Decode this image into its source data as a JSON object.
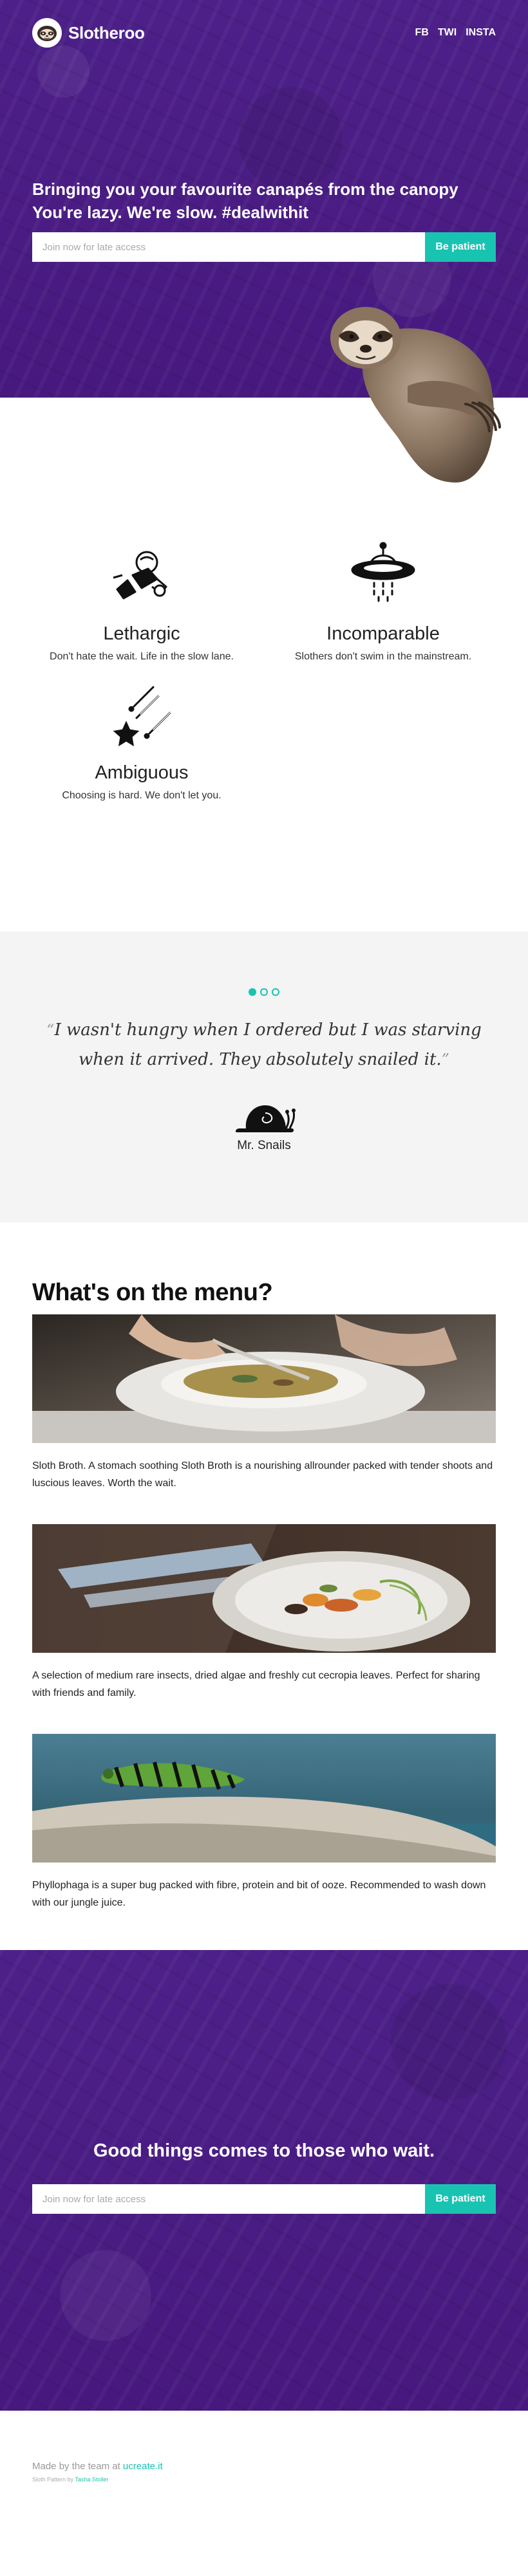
{
  "brand": {
    "name": "Slotheroo",
    "logo_icon": "sloth-face-icon"
  },
  "nav": {
    "items": [
      "FB",
      "TWI",
      "INSTA"
    ]
  },
  "hero": {
    "title": "Bringing you your favourite canapés from the canopy You're lazy. We're slow. #dealwithit",
    "input_placeholder": "Join now for late access",
    "button_label": "Be patient",
    "image_icon": "sloth-hanging-illustration"
  },
  "features": [
    {
      "icon": "astronaut-icon",
      "title": "Lethargic",
      "desc": "Don't hate the wait. Life in the slow lane."
    },
    {
      "icon": "ufo-icon",
      "title": "Incomparable",
      "desc": "Slothers don't swim in the mainstream."
    },
    {
      "icon": "shooting-stars-icon",
      "title": "Ambiguous",
      "desc": "Choosing is hard. We don't let you."
    }
  ],
  "testimonial": {
    "open_quote": "“",
    "close_quote": "”",
    "quote": "I wasn't hungry when I ordered but I was starving when it arrived. They absolutely snailed it.",
    "author": "Mr. Snails",
    "author_icon": "snail-icon",
    "slides": 3,
    "active_slide": 1
  },
  "menu": {
    "title": "What's on the menu?",
    "items": [
      {
        "image": "soup-bowl-photo",
        "desc": "Sloth Broth. A stomach soothing Sloth Broth is a nourishing allrounder packed with tender shoots and luscious leaves. Worth the wait."
      },
      {
        "image": "roasted-vegetables-plate-photo",
        "desc": "A selection of medium rare insects, dried algae and freshly cut cecropia leaves. Perfect for sharing with friends and family."
      },
      {
        "image": "caterpillar-on-branch-photo",
        "desc": "Phyllophaga is a super bug packed with fibre, protein and bit of ooze. Recommended to wash down with our jungle juice."
      }
    ]
  },
  "cta": {
    "title": "Good things comes to those who wait.",
    "input_placeholder": "Join now for late access",
    "button_label": "Be patient"
  },
  "footer": {
    "made_text": "Made by the team at",
    "made_link": "ucreate.it",
    "credit_text": "Sloth Pattern by",
    "credit_link": "Tasha Stoller"
  },
  "colors": {
    "purple": "#4b1f86",
    "teal": "#19c3b1"
  }
}
